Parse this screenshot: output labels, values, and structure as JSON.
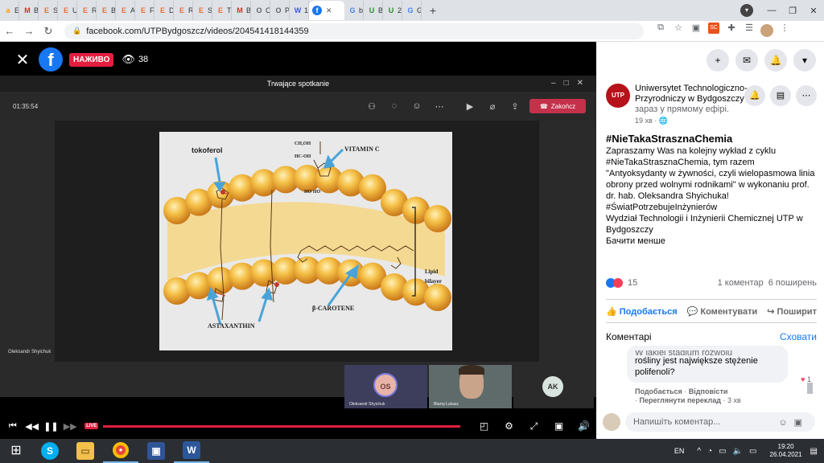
{
  "browser": {
    "tabs": [
      {
        "label": "Ed",
        "icon": "a"
      },
      {
        "label": "Bx",
        "icon": "M"
      },
      {
        "label": "Su",
        "icon": "E"
      },
      {
        "label": "Ul",
        "icon": "E"
      },
      {
        "label": "Re",
        "icon": "E"
      },
      {
        "label": "Bi",
        "icon": "E"
      },
      {
        "label": "A c",
        "icon": "E"
      },
      {
        "label": "Fe",
        "icon": "E"
      },
      {
        "label": "De",
        "icon": "E"
      },
      {
        "label": "Re",
        "icon": "E"
      },
      {
        "label": "S-",
        "icon": "E"
      },
      {
        "label": "Tr",
        "icon": "E"
      },
      {
        "label": "Bx",
        "icon": "M"
      },
      {
        "label": "O",
        "icon": "O"
      },
      {
        "label": "PC",
        "icon": "O"
      },
      {
        "label": "1",
        "icon": "W"
      }
    ],
    "active_tab_icon": "f",
    "active_tab_close": "✕",
    "tabs_after": [
      {
        "label": "bi",
        "icon": "G"
      },
      {
        "label": "Bi",
        "icon": "U"
      },
      {
        "label": "25",
        "icon": "U"
      },
      {
        "label": "Gc",
        "icon": "G"
      }
    ],
    "new_tab": "+",
    "url": "facebook.com/UTPBydgoszcz/videos/204541418144359",
    "extension_badge": "21"
  },
  "live_header": {
    "live_label": "НАЖИВО",
    "viewer_count": "38"
  },
  "teams": {
    "window_title": "Trwające spotkanie",
    "timer": "01:35:54",
    "hangup_label": "Zakończ",
    "presenter_label": "Oleksandr Shyichuk",
    "participants": [
      {
        "initials": "OS",
        "name": "Oleksandr Shyichuk"
      },
      {
        "initials": "",
        "name": "Błażej Łukasz"
      },
      {
        "initials": "AK",
        "name": ""
      }
    ]
  },
  "slide": {
    "labels": {
      "tokoferol": "tokoferol",
      "vitamin_c": "VITAMIN C",
      "lipid_bilayer_1": "Lipid",
      "lipid_bilayer_2": "bilayer",
      "astaxanthin": "ASTAXANTHIN",
      "beta_carotene": "β-CAROTENE",
      "ch_oh_1": "CH₂OH",
      "ch_oh_2": "HC-OH",
      "ho_ho": "HO  HO"
    },
    "colors": {
      "sphere": "#f2b43a",
      "sphere_dark": "#d88a18",
      "arrow": "#4aa3d8",
      "background": "#e9e9e9"
    }
  },
  "player": {
    "live_badge": "LIVE",
    "progress": 1.0
  },
  "post": {
    "page_name": "Uniwersytet Technologiczno-Przyrodniczy w Bydgoszczy",
    "status": "зараз у прямому ефірі.",
    "time": "19 хв ·",
    "hashtag_title": "#NieTakaStrasznaChemia",
    "body": "Zapraszamy Was na kolejny wykład z cyklu #NieTakaStrasznaChemia, tym razem \"Antyoksydanty w żywności, czyli wielopasmowa linia obrony przed wolnymi rodnikami\" w wykonaniu prof. dr. hab. Oleksandra Shyichuka!",
    "tags": "#ŚwiatPotrzebujeInżynierów",
    "dept": "Wydział Technologii i Inżynierii Chemicznej UTP w Bydgoszczy",
    "see_less": "Бачити менше",
    "reactions": "15",
    "comments": "1 коментар",
    "shares": "6 поширень",
    "like": "Подобається",
    "comment": "Коментувати",
    "share": "Поширити",
    "comments_header": "Коментарі",
    "hide": "Сховати",
    "comment_text_top": "W jakiej stadium rozwoju",
    "comment_text": "rośliny jest największe stężenie polifenoli?",
    "comment_reacts": "1",
    "comment_like": "Подобається",
    "comment_reply": "Відповісти",
    "comment_translate": "Переглянути переклад",
    "comment_time": "3 хв",
    "compose_placeholder": "Напишіть коментар..."
  },
  "taskbar": {
    "lang": "EN",
    "time": "19:20",
    "date": "26.04.2021"
  }
}
